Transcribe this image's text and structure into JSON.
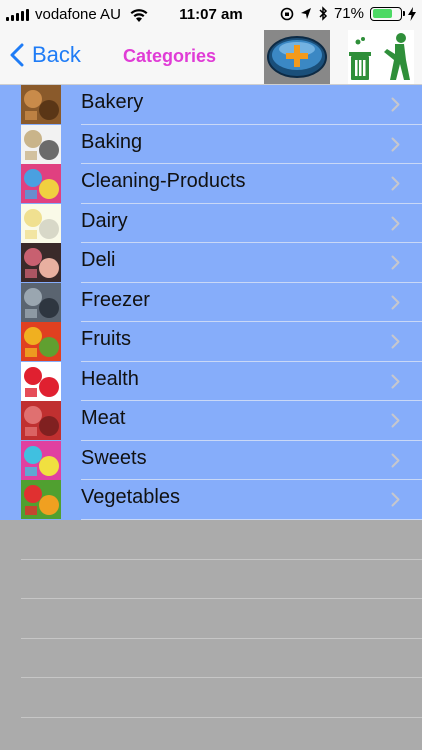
{
  "status": {
    "carrier": "vodafone AU",
    "time": "11:07 am",
    "battery": "71%",
    "battery_level": 0.71
  },
  "nav": {
    "back_label": "Back",
    "title": "Categories"
  },
  "categories": [
    {
      "label": "Bakery",
      "icon": "bakery-icon",
      "colors": [
        "#8a5a2b",
        "#c98b4a",
        "#5a3616"
      ]
    },
    {
      "label": "Baking",
      "icon": "baking-icon",
      "colors": [
        "#f2f2f2",
        "#c9b48a",
        "#6b6b6b"
      ]
    },
    {
      "label": "Cleaning-Products",
      "icon": "cleaning-products-icon",
      "colors": [
        "#e04080",
        "#4aa0e0",
        "#f0d040"
      ]
    },
    {
      "label": "Dairy",
      "icon": "dairy-icon",
      "colors": [
        "#fafae8",
        "#f0e090",
        "#d8d8c8"
      ]
    },
    {
      "label": "Deli",
      "icon": "deli-icon",
      "colors": [
        "#3a2a2a",
        "#c86070",
        "#e8b0a0"
      ]
    },
    {
      "label": "Freezer",
      "icon": "freezer-icon",
      "colors": [
        "#5a6470",
        "#9aa6b0",
        "#2e3640"
      ]
    },
    {
      "label": "Fruits",
      "icon": "fruits-icon",
      "colors": [
        "#e04020",
        "#f0b020",
        "#60a030"
      ]
    },
    {
      "label": "Health",
      "icon": "health-icon",
      "colors": [
        "#ffffff",
        "#e02030",
        "#e02030"
      ]
    },
    {
      "label": "Meat",
      "icon": "meat-icon",
      "colors": [
        "#c03030",
        "#e07070",
        "#802020"
      ]
    },
    {
      "label": "Sweets",
      "icon": "sweets-icon",
      "colors": [
        "#e040a0",
        "#40c0e0",
        "#f0e040"
      ]
    },
    {
      "label": "Vegetables",
      "icon": "vegetables-icon",
      "colors": [
        "#50a030",
        "#e03030",
        "#f0a020"
      ]
    }
  ],
  "theme": {
    "list_bg": "#86adfa",
    "empty_bg": "#ababab",
    "title_color": "#e03cd6",
    "back_color": "#1f7cf6"
  }
}
